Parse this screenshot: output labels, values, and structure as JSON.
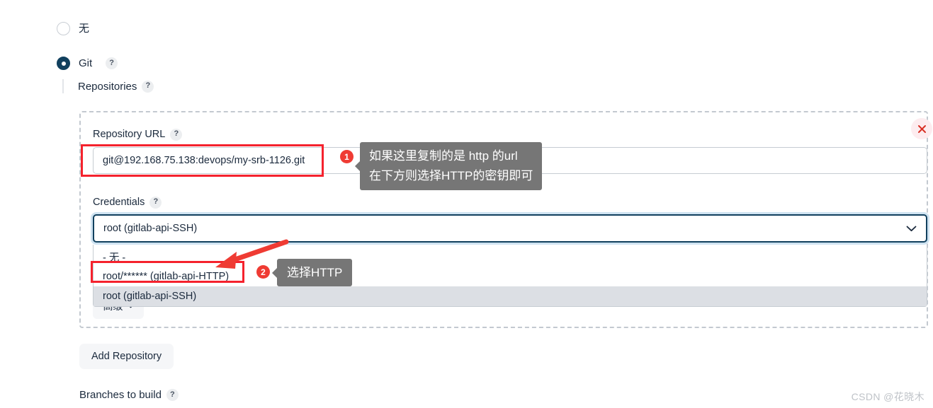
{
  "scm_options": [
    {
      "label": "无",
      "selected": false
    },
    {
      "label": "Git",
      "selected": true,
      "help": "?"
    }
  ],
  "section": {
    "title": "Repositories",
    "help": "?"
  },
  "repository": {
    "url_label": "Repository URL",
    "url_help": "?",
    "url_value": "git@192.168.75.138:devops/my-srb-1126.git",
    "credentials_label": "Credentials",
    "credentials_help": "?",
    "credentials_value": "root (gitlab-api-SSH)",
    "credentials_options": [
      {
        "label": "- 无 -",
        "highlighted": false
      },
      {
        "label": "root/****** (gitlab-api-HTTP)",
        "highlighted": false
      },
      {
        "label": "root (gitlab-api-SSH)",
        "highlighted": true
      }
    ],
    "advanced_label": "高级",
    "close_icon": "close-icon",
    "chevron_icon": "chevron-down-icon"
  },
  "buttons": {
    "add_repository": "Add Repository"
  },
  "branches": {
    "label": "Branches to build",
    "help": "?"
  },
  "annotations": [
    {
      "number": "1",
      "text": "如果这里复制的是 http 的url\n在下方则选择HTTP的密钥即可"
    },
    {
      "number": "2",
      "text": "选择HTTP"
    }
  ],
  "watermark": "CSDN @花晓木",
  "colors": {
    "accent": "#11405e",
    "annotation_red": "#f5222d",
    "badge_red": "#ef3b33",
    "callout_gray": "#767676",
    "focus_ring": "#cfe3f1"
  }
}
